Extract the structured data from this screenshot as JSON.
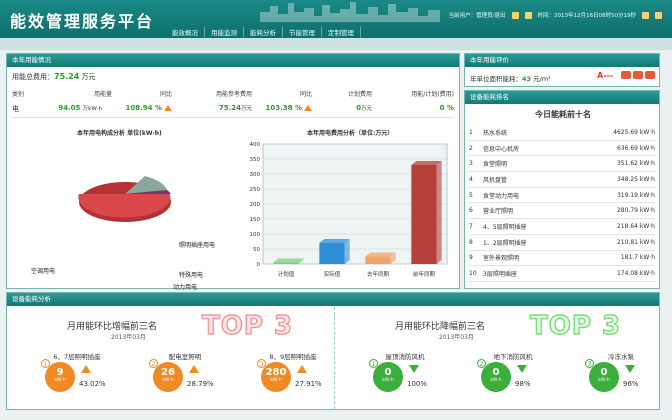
{
  "header": {
    "title": "能效管理服务平台",
    "user": "当前用户：管理员/退出",
    "time": "时间：2013年12月16日08时50分19秒",
    "nav": [
      "能效概况",
      "用能监测",
      "能耗分析",
      "节能管理",
      "定制管理"
    ]
  },
  "usage": {
    "panel_title": "本年用能情况",
    "total_label": "用能总费用：",
    "total_value": "75.24",
    "total_unit": "万元",
    "headers": [
      "类别",
      "用能量",
      "同比",
      "用能参考费用",
      "同比",
      "计划费用",
      "用能/计划(费用)"
    ],
    "row": {
      "cat": "电",
      "amount": "94.05",
      "amount_unit": "万kW·h",
      "yoy": "108.94 %",
      "ref_cost": "75.24",
      "ref_unit": "万元",
      "ref_yoy": "103.38 %",
      "plan": "0",
      "plan_unit": "万元",
      "ratio": "0 %"
    }
  },
  "pie": {
    "title": "本年用电构成分析 单位(kW·h)",
    "labels": [
      "照明插座用电",
      "特殊用电",
      "动力用电",
      "空调用电"
    ]
  },
  "chart_data": {
    "type": "bar",
    "title": "本年用电费用分析（单位:万元）",
    "categories": [
      "计划值",
      "实际值",
      "去年同期",
      "前年同期"
    ],
    "values": [
      5,
      70,
      25,
      330
    ],
    "ylim": [
      0,
      400
    ],
    "yticks": [
      0,
      50,
      100,
      150,
      200,
      250,
      300,
      350,
      400
    ],
    "colors": [
      "#7fd07f",
      "#2f8fd6",
      "#f0a36b",
      "#b5413a"
    ],
    "grid": true
  },
  "eval": {
    "panel_title": "本年用能评价",
    "label": "年单位面积能耗：",
    "value": "43",
    "unit": "元/m²",
    "grade": "A---"
  },
  "rank": {
    "panel_title": "设备能耗排名",
    "title": "今日能耗前十名",
    "items": [
      {
        "n": "1",
        "name": "热水系统",
        "v": "4625.69 kW·h"
      },
      {
        "n": "2",
        "name": "信息中心机房",
        "v": "636.69 kW·h"
      },
      {
        "n": "3",
        "name": "食堂照明",
        "v": "351.62 kW·h"
      },
      {
        "n": "4",
        "name": "风机盘管",
        "v": "348.25 kW·h"
      },
      {
        "n": "5",
        "name": "食堂动力用电",
        "v": "319.19 kW·h"
      },
      {
        "n": "6",
        "name": "营业厅照明",
        "v": "280.79 kW·h"
      },
      {
        "n": "7",
        "name": "4、5层照明插座",
        "v": "218.64 kW·h"
      },
      {
        "n": "8",
        "name": "1、2层照明插座",
        "v": "210.81 kW·h"
      },
      {
        "n": "9",
        "name": "室外景观照明",
        "v": "181.7 kW·h"
      },
      {
        "n": "10",
        "name": "3层照明插座",
        "v": "174.08 kW·h"
      }
    ]
  },
  "analysis": {
    "panel_title": "设备能耗分析",
    "inc": {
      "title": "月用能环比增幅前三名",
      "date": "2013年03月",
      "top": "TOP 3",
      "items": [
        {
          "rank": "1",
          "name": "6、7层照明插座",
          "value": "9",
          "unit": "kW·h",
          "pct": "43.02%"
        },
        {
          "rank": "2",
          "name": "配电室照明",
          "value": "26",
          "unit": "kW·h",
          "pct": "28.79%"
        },
        {
          "rank": "3",
          "name": "8、9层照明插座",
          "value": "280",
          "unit": "kW·h",
          "pct": "27.91%"
        }
      ]
    },
    "dec": {
      "title": "月用能环比降幅前三名",
      "date": "2013年03月",
      "top": "TOP 3",
      "items": [
        {
          "rank": "1",
          "name": "屋顶消防风机",
          "value": "0",
          "unit": "kW·h",
          "pct": "100%"
        },
        {
          "rank": "2",
          "name": "地下消防风机",
          "value": "0",
          "unit": "kW·h",
          "pct": "98%"
        },
        {
          "rank": "3",
          "name": "冷冻水泵",
          "value": "0",
          "unit": "kW·h",
          "pct": "96%"
        }
      ]
    }
  }
}
